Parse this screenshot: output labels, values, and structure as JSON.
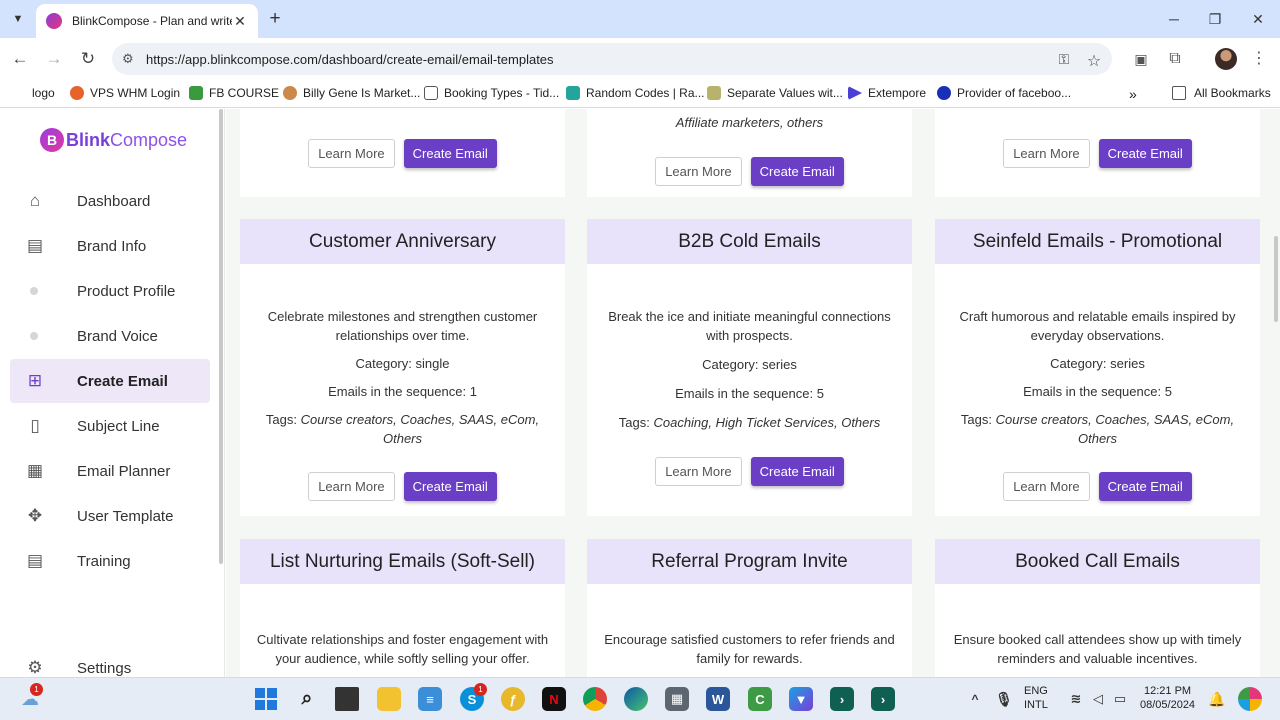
{
  "browser": {
    "tab_title": "BlinkCompose - Plan and write",
    "url": "https://app.blinkcompose.com/dashboard/create-email/email-templates",
    "bookmarks": [
      {
        "label": "logo",
        "color": "#ffffff"
      },
      {
        "label": "VPS WHM Login",
        "color": "#e8622c"
      },
      {
        "label": "FB COURSE",
        "color": "#3a9a3e"
      },
      {
        "label": "Billy Gene Is Market...",
        "color": "#c98a4b"
      },
      {
        "label": "Booking Types - Tid...",
        "color": "#555555"
      },
      {
        "label": "Random Codes | Ra...",
        "color": "#23a59b"
      },
      {
        "label": "Separate Values wit...",
        "color": "#b7b36c"
      },
      {
        "label": "Extempore",
        "color": "#4b3fd6"
      },
      {
        "label": "Provider of faceboo...",
        "color": "#1a2fb8"
      }
    ],
    "all_bookmarks": "All Bookmarks"
  },
  "sidebar": {
    "brand_bold": "Blink",
    "brand_rest": "Compose",
    "items": [
      {
        "label": "Dashboard",
        "icon": "home-icon"
      },
      {
        "label": "Brand Info",
        "icon": "message-icon"
      },
      {
        "label": "Product Profile",
        "icon": "dot"
      },
      {
        "label": "Brand Voice",
        "icon": "dot"
      },
      {
        "label": "Create Email",
        "icon": "file-plus-icon",
        "active": true
      },
      {
        "label": "Subject Line",
        "icon": "document-icon"
      },
      {
        "label": "Email Planner",
        "icon": "calendar-icon"
      },
      {
        "label": "User Template",
        "icon": "move-icon"
      },
      {
        "label": "Training",
        "icon": "chat-icon"
      },
      {
        "label": "Settings",
        "icon": "gear-icon"
      }
    ]
  },
  "cards_top": [
    {
      "tags_tail": "Affiliate marketers, others",
      "learn": "Learn More",
      "create": "Create Email"
    },
    {
      "learn": "Learn More",
      "create": "Create Email"
    },
    {
      "learn": "Learn More",
      "create": "Create Email"
    }
  ],
  "cards": [
    {
      "title": "Customer Anniversary",
      "desc": "Celebrate milestones and strengthen customer relationships over time.",
      "category": "Category: single",
      "emails": "Emails in the sequence: 1",
      "tags_label": "Tags:",
      "tags": "Course creators, Coaches, SAAS, eCom, Others",
      "learn": "Learn More",
      "create": "Create Email"
    },
    {
      "title": "B2B Cold Emails",
      "desc": "Break the ice and initiate meaningful connections with prospects.",
      "category": "Category: series",
      "emails": "Emails in the sequence: 5",
      "tags_label": "Tags:",
      "tags": "Coaching, High Ticket Services, Others",
      "learn": "Learn More",
      "create": "Create Email"
    },
    {
      "title": "Seinfeld Emails - Promotional",
      "desc": "Craft humorous and relatable emails inspired by everyday observations.",
      "category": "Category: series",
      "emails": "Emails in the sequence: 5",
      "tags_label": "Tags:",
      "tags": "Course creators, Coaches, SAAS, eCom, Others",
      "learn": "Learn More",
      "create": "Create Email"
    }
  ],
  "cards_bottom": [
    {
      "title": "List Nurturing Emails (Soft-Sell)",
      "desc": "Cultivate relationships and foster engagement with your audience, while softly selling your offer."
    },
    {
      "title": "Referral Program Invite",
      "desc": "Encourage satisfied customers to refer friends and family for rewards."
    },
    {
      "title": "Booked Call Emails",
      "desc": "Ensure booked call attendees show up with timely reminders and valuable incentives."
    }
  ],
  "taskbar": {
    "lang_top": "ENG",
    "lang_bottom": "INTL",
    "time": "12:21 PM",
    "date": "08/05/2024",
    "badge_weather": "1",
    "badge_skype": "1"
  },
  "colors": {
    "accent": "#6a3fc6",
    "card_header": "#e8e2fb",
    "active_nav": "#ede7f8"
  }
}
